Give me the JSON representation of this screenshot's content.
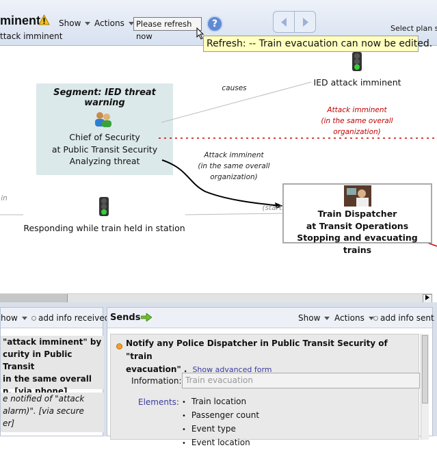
{
  "header": {
    "title": "minent",
    "subtitle": "ttack imminent",
    "show_label": "Show",
    "actions_label": "Actions",
    "refresh_button": "Please refresh now",
    "help_symbol": "?",
    "select_plan": "Select plan se",
    "tooltip": "Refresh: -- Train evacuation can now be edited.",
    "icons": [
      "warning-icon",
      "help-icon",
      "previous-icon",
      "next-icon"
    ]
  },
  "diagram": {
    "segment_title": "Segment: IED threat warning",
    "chief_lines": [
      "Chief of Security",
      "at Public Transit Security",
      "Analyzing threat"
    ],
    "ied_label": "IED attack imminent",
    "causes_label": "causes",
    "red_label_lines": [
      "Attack imminent",
      "(in the same overall",
      "organization)"
    ],
    "black_label_lines": [
      "Attack imminent",
      "(in the same overall",
      "organization)"
    ],
    "in_label": "in",
    "starts_label": "(starts)",
    "responding_label": "Responding while train held in station",
    "dispatcher_lines": [
      "Train Dispatcher",
      "at Transit Operations",
      "Stopping and evacuating trains"
    ],
    "colors": {
      "red_edge": "#cc0000",
      "segment_bg": "#dce9ea"
    }
  },
  "left_panel": {
    "show_label": "how",
    "add_info": "add info received",
    "item1_lines": [
      "\"attack imminent\" by",
      "curity in Public Transit",
      "in the same overall",
      "n. [via phone]"
    ],
    "item2_lines": [
      "e notified of \"attack",
      "alarm)\". [via secure",
      "er]"
    ]
  },
  "sends_panel": {
    "title": "Sends",
    "show_label": "Show",
    "actions_label": "Actions",
    "add_info": "add info sent",
    "notify_line1": "Notify any Police Dispatcher in Public Transit Security of \"train",
    "notify_line2": "evacuation\" .",
    "advanced_link": "Show advanced form",
    "information_label": "Information:",
    "information_value": "Train evacuation",
    "elements_label": "Elements:",
    "elements": [
      "Train location",
      "Passenger count",
      "Event type",
      "Event location"
    ]
  }
}
